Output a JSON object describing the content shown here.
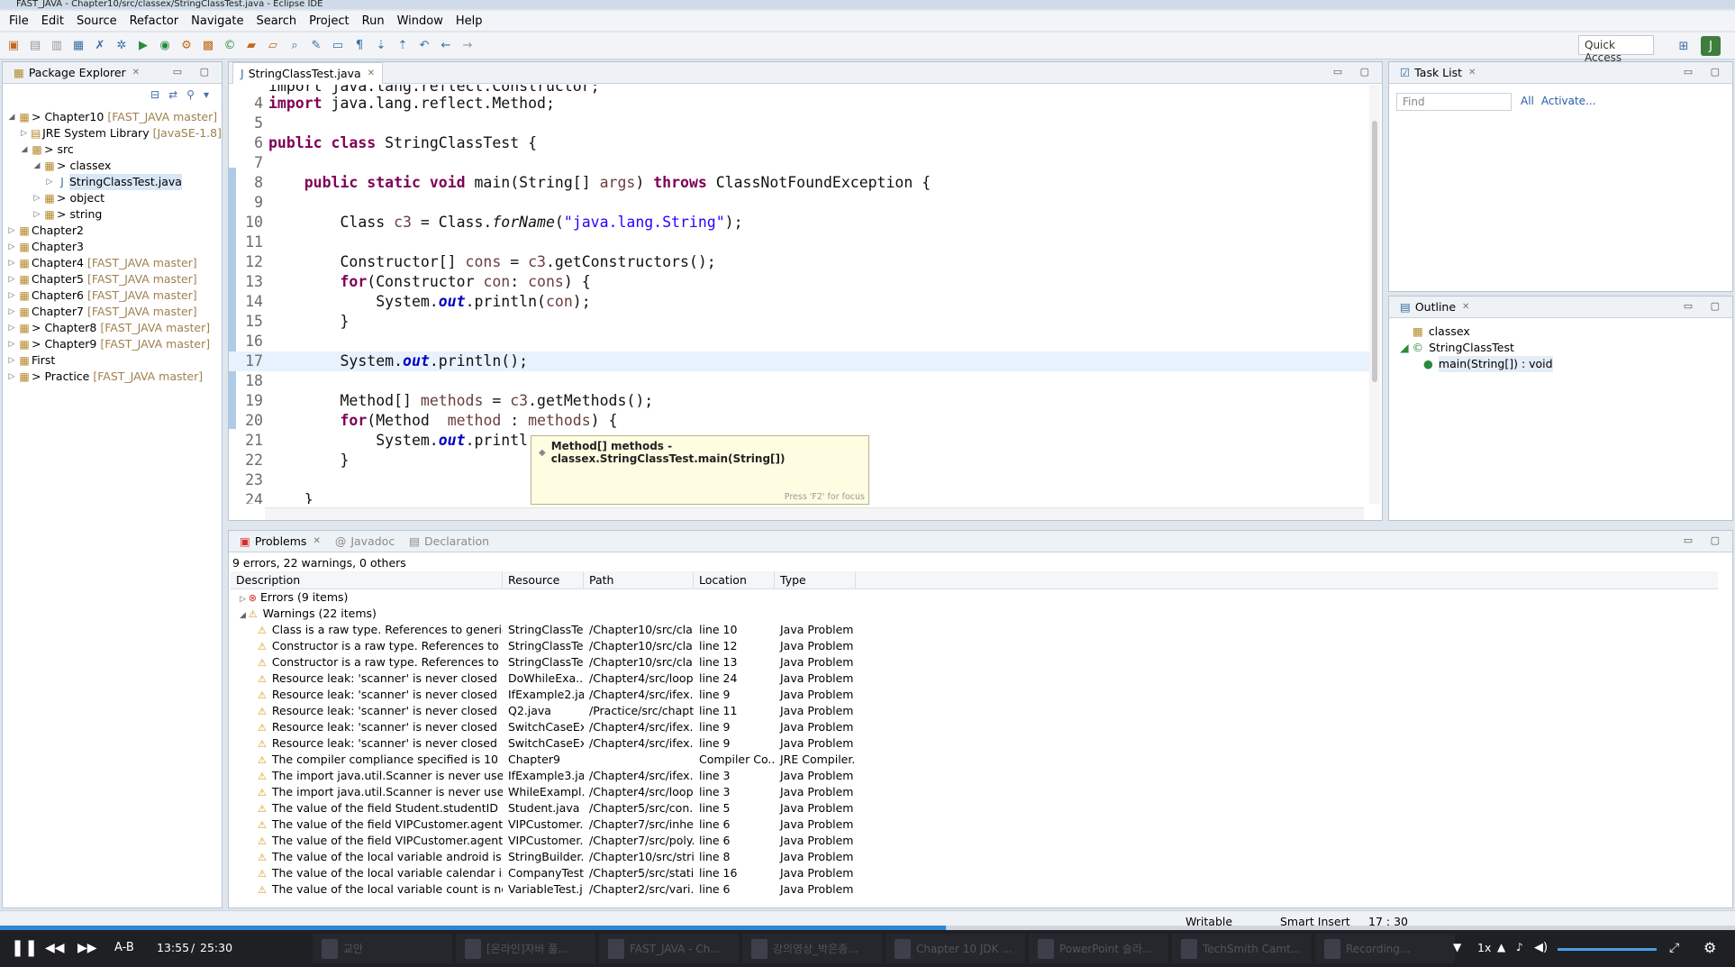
{
  "window": {
    "title": "FAST_JAVA - Chapter10/src/classex/StringClassTest.java - Eclipse IDE"
  },
  "menu": [
    "File",
    "Edit",
    "Source",
    "Refactor",
    "Navigate",
    "Search",
    "Project",
    "Run",
    "Window",
    "Help"
  ],
  "toolbar": {
    "quick_access": "Quick Access"
  },
  "package_explorer": {
    "title": "Package Explorer",
    "items": [
      {
        "label": "> Chapter10",
        "repo": "[FAST_JAVA master]"
      },
      {
        "label": "JRE System Library",
        "repo": "[JavaSE-1.8]"
      },
      {
        "label": "> src",
        "repo": ""
      },
      {
        "label": "> classex",
        "repo": ""
      },
      {
        "label": "StringClassTest.java",
        "repo": ""
      },
      {
        "label": "> object",
        "repo": ""
      },
      {
        "label": "> string",
        "repo": ""
      },
      {
        "label": "Chapter2",
        "repo": ""
      },
      {
        "label": "Chapter3",
        "repo": ""
      },
      {
        "label": "Chapter4",
        "repo": "[FAST_JAVA master]"
      },
      {
        "label": "Chapter5",
        "repo": "[FAST_JAVA master]"
      },
      {
        "label": "Chapter6",
        "repo": "[FAST_JAVA master]"
      },
      {
        "label": "Chapter7",
        "repo": "[FAST_JAVA master]"
      },
      {
        "label": "> Chapter8",
        "repo": "[FAST_JAVA master]"
      },
      {
        "label": "> Chapter9",
        "repo": "[FAST_JAVA master]"
      },
      {
        "label": "First",
        "repo": ""
      },
      {
        "label": "> Practice",
        "repo": "[FAST_JAVA master]"
      }
    ]
  },
  "editor": {
    "tab": "StringClassTest.java",
    "line_numbers": [
      "4",
      "5",
      "6",
      "7",
      "8",
      "9",
      "10",
      "11",
      "12",
      "13",
      "14",
      "15",
      "16",
      "17",
      "18",
      "19",
      "20",
      "21",
      "22",
      "23",
      "24"
    ],
    "top_partial": "import java.lang.reflect.Constructor;",
    "tooltip": {
      "text": "Method[] methods - classex.StringClassTest.main(String[])",
      "footer": "Press 'F2' for focus"
    }
  },
  "task_list": {
    "title": "Task List",
    "find_placeholder": "Find",
    "all": "All",
    "activate": "Activate..."
  },
  "outline": {
    "title": "Outline",
    "items": [
      "classex",
      "StringClassTest",
      "main(String[]) : void"
    ]
  },
  "problems": {
    "tabs": [
      "Problems",
      "Javadoc",
      "Declaration"
    ],
    "summary": "9 errors, 22 warnings, 0 others",
    "columns": [
      "Description",
      "Resource",
      "Path",
      "Location",
      "Type"
    ],
    "errors_group": "Errors (9 items)",
    "warnings_group": "Warnings (22 items)",
    "rows": [
      [
        "Class is a raw type. References to generic typ",
        "StringClassTe...",
        "/Chapter10/src/cla...",
        "line 10",
        "Java Problem"
      ],
      [
        "Constructor is a raw type. References to gene",
        "StringClassTe...",
        "/Chapter10/src/cla...",
        "line 12",
        "Java Problem"
      ],
      [
        "Constructor is a raw type. References to gene",
        "StringClassTe...",
        "/Chapter10/src/cla...",
        "line 13",
        "Java Problem"
      ],
      [
        "Resource leak: 'scanner' is never closed",
        "DoWhileExa...",
        "/Chapter4/src/loop...",
        "line 24",
        "Java Problem"
      ],
      [
        "Resource leak: 'scanner' is never closed",
        "IfExample2.ja...",
        "/Chapter4/src/ifex...",
        "line 9",
        "Java Problem"
      ],
      [
        "Resource leak: 'scanner' is never closed",
        "Q2.java",
        "/Practice/src/chapt...",
        "line 11",
        "Java Problem"
      ],
      [
        "Resource leak: 'scanner' is never closed",
        "SwitchCaseEx...",
        "/Chapter4/src/ifex...",
        "line 9",
        "Java Problem"
      ],
      [
        "Resource leak: 'scanner' is never closed",
        "SwitchCaseEx...",
        "/Chapter4/src/ifex...",
        "line 9",
        "Java Problem"
      ],
      [
        "The compiler compliance specified is 10 but",
        "Chapter9",
        "",
        "Compiler Co...",
        "JRE Compiler..."
      ],
      [
        "The import java.util.Scanner is never used",
        "IfExample3.ja...",
        "/Chapter4/src/ifex...",
        "line 3",
        "Java Problem"
      ],
      [
        "The import java.util.Scanner is never used",
        "WhileExampl...",
        "/Chapter4/src/loop...",
        "line 3",
        "Java Problem"
      ],
      [
        "The value of the field Student.studentID is nc",
        "Student.java",
        "/Chapter5/src/con...",
        "line 5",
        "Java Problem"
      ],
      [
        "The value of the field VIPCustomer.agentID is",
        "VIPCustomer....",
        "/Chapter7/src/inhe...",
        "line 6",
        "Java Problem"
      ],
      [
        "The value of the field VIPCustomer.agentID is",
        "VIPCustomer....",
        "/Chapter7/src/poly...",
        "line 6",
        "Java Problem"
      ],
      [
        "The value of the local variable android is not",
        "StringBuilder...",
        "/Chapter10/src/stri...",
        "line 8",
        "Java Problem"
      ],
      [
        "The value of the local variable calendar is not",
        "CompanyTest...",
        "/Chapter5/src/stati...",
        "line 16",
        "Java Problem"
      ],
      [
        "The value of the local variable count is not us",
        "VariableTest.j...",
        "/Chapter2/src/vari...",
        "line 6",
        "Java Problem"
      ]
    ]
  },
  "status": {
    "writable": "Writable",
    "insert": "Smart Insert",
    "position": "17 : 30"
  },
  "player": {
    "ab": "A-B",
    "current": "13:55",
    "sep": "/",
    "total": "25:30",
    "speed": "1x",
    "progress": 0.545
  },
  "taskbar_apps": [
    "교안",
    "[온라인]자바 풀...",
    "FAST_JAVA - Ch...",
    "강의영상_박은종...",
    "Chapter 10 JDK ...",
    "PowerPoint 슬라...",
    "TechSmith Camt...",
    "Recording..."
  ],
  "colors": {
    "keyword": "#7f0055",
    "string": "#2a00ff",
    "static_field": "#0000c0",
    "local_var": "#6a3e3e",
    "progress": "#2f86d4"
  }
}
